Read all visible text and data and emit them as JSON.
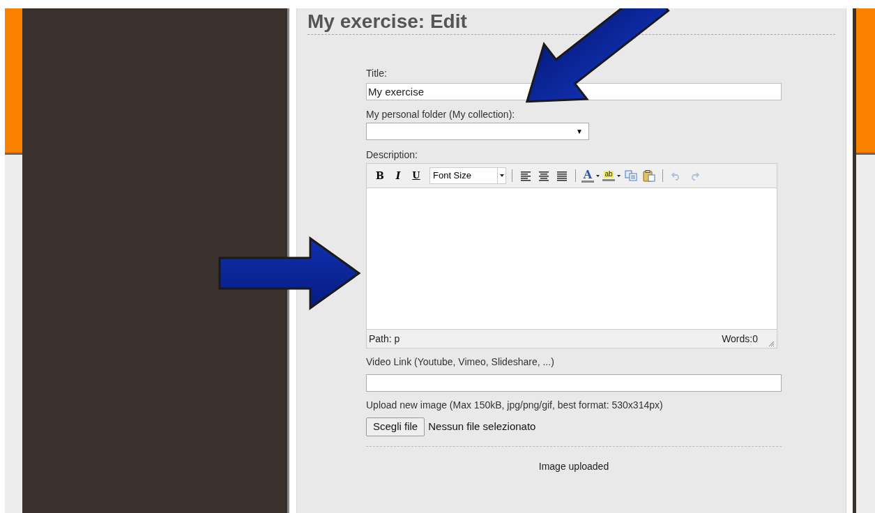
{
  "page_title": "My exercise: Edit",
  "form": {
    "title": {
      "label": "Title:",
      "value": "My exercise"
    },
    "folder": {
      "label": "My personal folder (My collection):",
      "arrow": "▼"
    },
    "description": {
      "label": "Description:",
      "toolbar": [
        {
          "kind": "bold",
          "label": "B",
          "disabled": false
        },
        {
          "kind": "italic",
          "label": "I",
          "disabled": false
        },
        {
          "kind": "underline",
          "label": "U",
          "disabled": false
        },
        {
          "kind": "fontsize",
          "label": "Font Size",
          "disabled": false
        },
        {
          "kind": "separator"
        },
        {
          "kind": "align-left",
          "disabled": false
        },
        {
          "kind": "align-center",
          "disabled": false
        },
        {
          "kind": "justify",
          "disabled": false
        },
        {
          "kind": "separator"
        },
        {
          "kind": "text-color",
          "label": "A",
          "disabled": false
        },
        {
          "kind": "highlight",
          "label": "ab",
          "disabled": false
        },
        {
          "kind": "copy",
          "disabled": false
        },
        {
          "kind": "paste",
          "disabled": false
        },
        {
          "kind": "separator"
        },
        {
          "kind": "undo",
          "disabled": true
        },
        {
          "kind": "redo",
          "disabled": true
        }
      ],
      "path": "Path: p",
      "words": "Words:0"
    },
    "video": {
      "label": "Video Link (Youtube, Vimeo, Slideshare, ...)"
    },
    "upload": {
      "label": "Upload new image (Max 150kB, jpg/png/gif, best format: 530x314px)",
      "button": "Scegli file",
      "status": "Nessun file selezionato"
    },
    "uploaded_note": "Image uploaded"
  }
}
